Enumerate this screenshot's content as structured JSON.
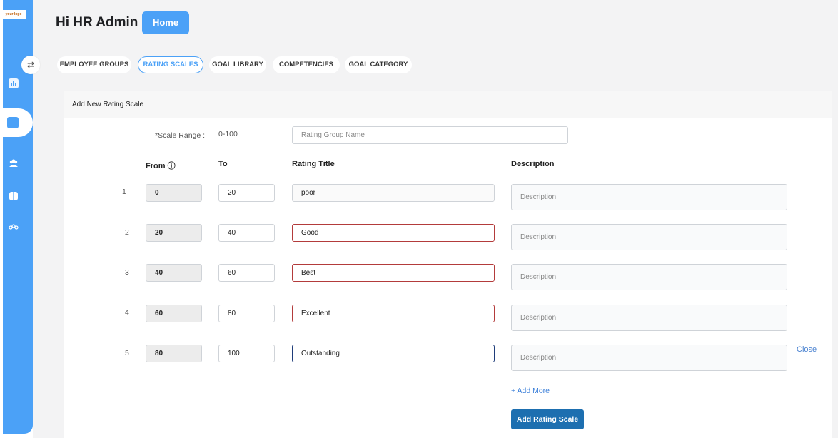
{
  "sidebar": {
    "logo_text": "your logo",
    "items": [
      {
        "icon": "bar-chart-icon"
      },
      {
        "icon": "grid-icon"
      },
      {
        "icon": "users-icon"
      },
      {
        "icon": "book-icon"
      },
      {
        "icon": "team-icon"
      }
    ]
  },
  "header": {
    "greeting": "Hi HR Admin",
    "home_label": "Home"
  },
  "tabs": [
    {
      "label": "EMPLOYEE GROUPS",
      "active": false
    },
    {
      "label": "RATING SCALES",
      "active": true
    },
    {
      "label": "GOAL LIBRARY",
      "active": false
    },
    {
      "label": "COMPETENCIES",
      "active": false
    },
    {
      "label": "GOAL CATEGORY",
      "active": false
    }
  ],
  "form": {
    "title": "Add New Rating Scale",
    "scale_range_label": "*Scale Range :",
    "scale_range_value": "0-100",
    "group_name_placeholder": "Rating Group Name",
    "columns": {
      "from": "From",
      "to": "To",
      "rating_title": "Rating Title",
      "description": "Description"
    },
    "rows": [
      {
        "num": "1",
        "from": "0",
        "to": "20",
        "title": "poor",
        "description_placeholder": "Description"
      },
      {
        "num": "2",
        "from": "20",
        "to": "40",
        "title": "Good",
        "description_placeholder": "Description"
      },
      {
        "num": "3",
        "from": "40",
        "to": "60",
        "title": "Best",
        "description_placeholder": "Description"
      },
      {
        "num": "4",
        "from": "60",
        "to": "80",
        "title": "Excellent",
        "description_placeholder": "Description"
      },
      {
        "num": "5",
        "from": "80",
        "to": "100",
        "title": "Outstanding",
        "description_placeholder": "Description"
      }
    ],
    "close_label": "Close",
    "add_more_label": "+ Add More",
    "submit_label": "Add Rating Scale"
  },
  "colors": {
    "accent": "#4ba1f7",
    "error": "#b33b3b",
    "submit": "#1d6fb0"
  }
}
